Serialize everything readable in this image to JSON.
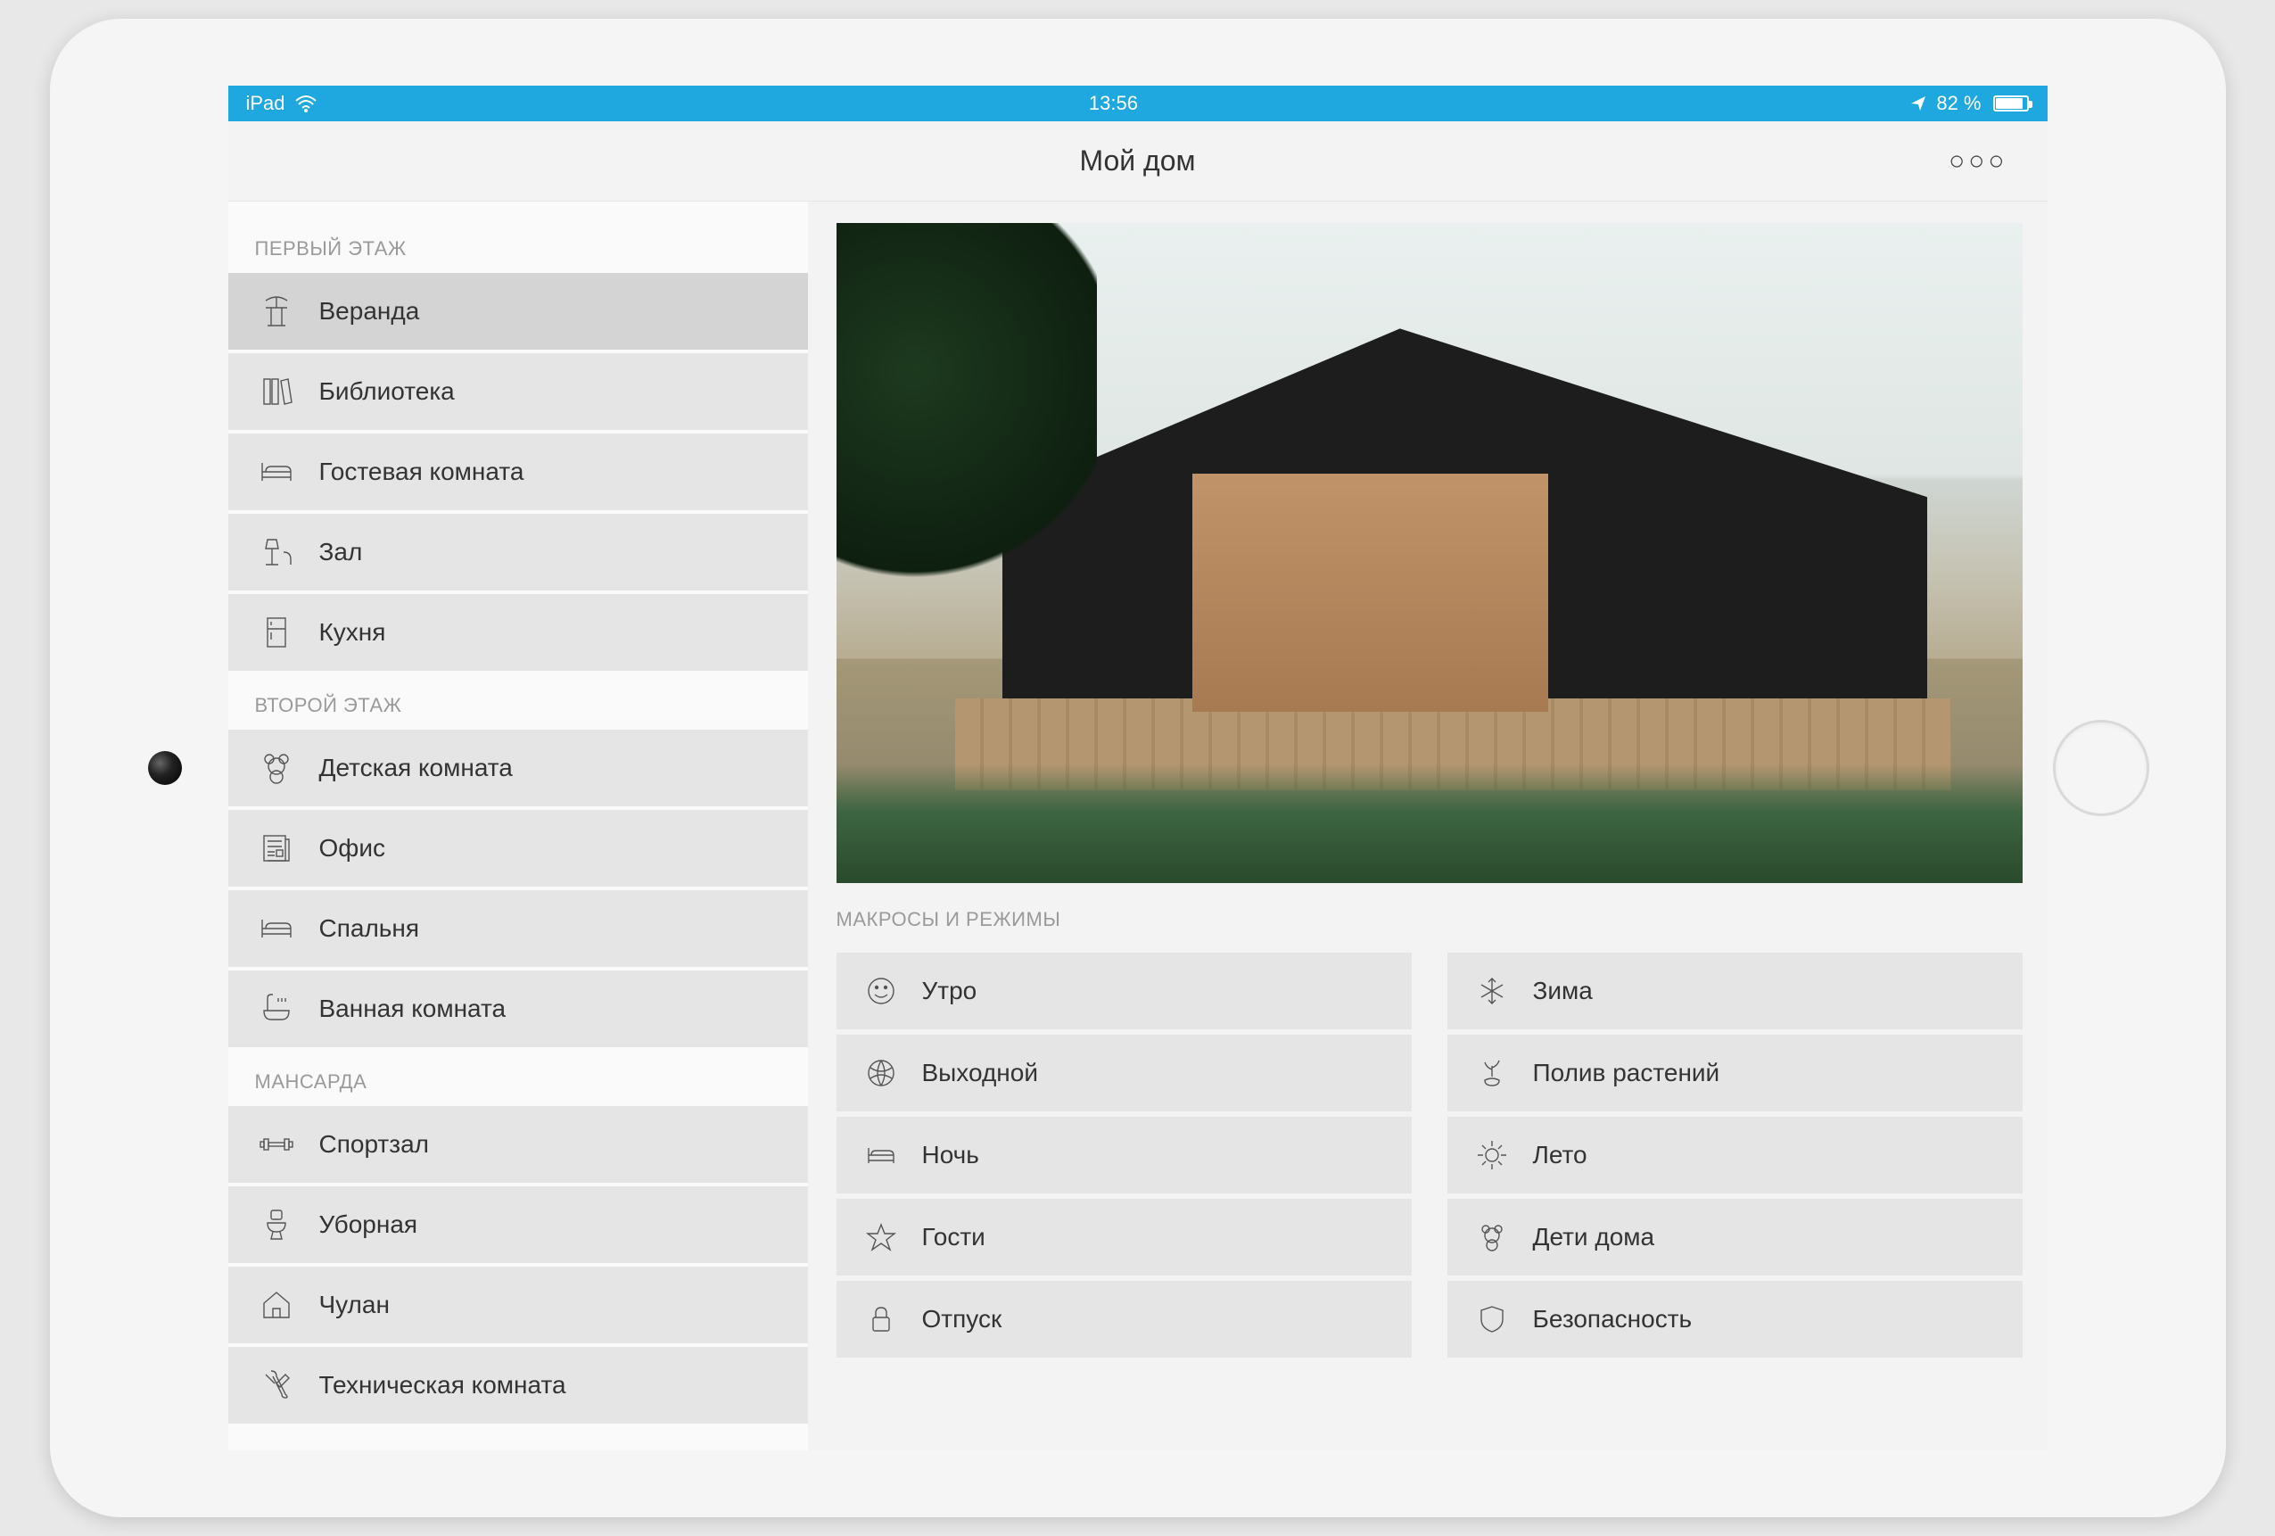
{
  "status_bar": {
    "device": "iPad",
    "time": "13:56",
    "battery_text": "82 %",
    "battery_level": 82
  },
  "header": {
    "title": "Мой дом"
  },
  "sidebar": {
    "sections": [
      {
        "title": "ПЕРВЫЙ ЭТАЖ",
        "items": [
          {
            "label": "Веранда",
            "icon": "veranda-icon",
            "selected": true
          },
          {
            "label": "Библиотека",
            "icon": "library-icon"
          },
          {
            "label": "Гостевая комната",
            "icon": "bed-icon"
          },
          {
            "label": "Зал",
            "icon": "lamp-icon"
          },
          {
            "label": "Кухня",
            "icon": "fridge-icon"
          }
        ]
      },
      {
        "title": "ВТОРОЙ ЭТАЖ",
        "items": [
          {
            "label": "Детская комната",
            "icon": "teddy-icon"
          },
          {
            "label": "Офис",
            "icon": "newspaper-icon"
          },
          {
            "label": "Спальня",
            "icon": "bed-icon"
          },
          {
            "label": "Ванная комната",
            "icon": "bath-icon"
          }
        ]
      },
      {
        "title": "МАНСАРДА",
        "items": [
          {
            "label": "Спортзал",
            "icon": "dumbbell-icon"
          },
          {
            "label": "Уборная",
            "icon": "toilet-icon"
          },
          {
            "label": "Чулан",
            "icon": "house-box-icon"
          },
          {
            "label": "Техническая комната",
            "icon": "tools-icon"
          }
        ]
      }
    ]
  },
  "macros": {
    "title": "МАКРОСЫ И РЕЖИМЫ",
    "left": [
      {
        "label": "Утро",
        "icon": "smile-icon"
      },
      {
        "label": "Выходной",
        "icon": "ball-icon"
      },
      {
        "label": "Ночь",
        "icon": "bed-icon"
      },
      {
        "label": "Гости",
        "icon": "star-icon"
      },
      {
        "label": "Отпуск",
        "icon": "lock-icon"
      }
    ],
    "right": [
      {
        "label": "Зима",
        "icon": "snow-icon"
      },
      {
        "label": "Полив растений",
        "icon": "plant-icon"
      },
      {
        "label": "Лето",
        "icon": "sun-icon"
      },
      {
        "label": "Дети дома",
        "icon": "teddy-icon"
      },
      {
        "label": "Безопасность",
        "icon": "shield-icon"
      }
    ]
  }
}
